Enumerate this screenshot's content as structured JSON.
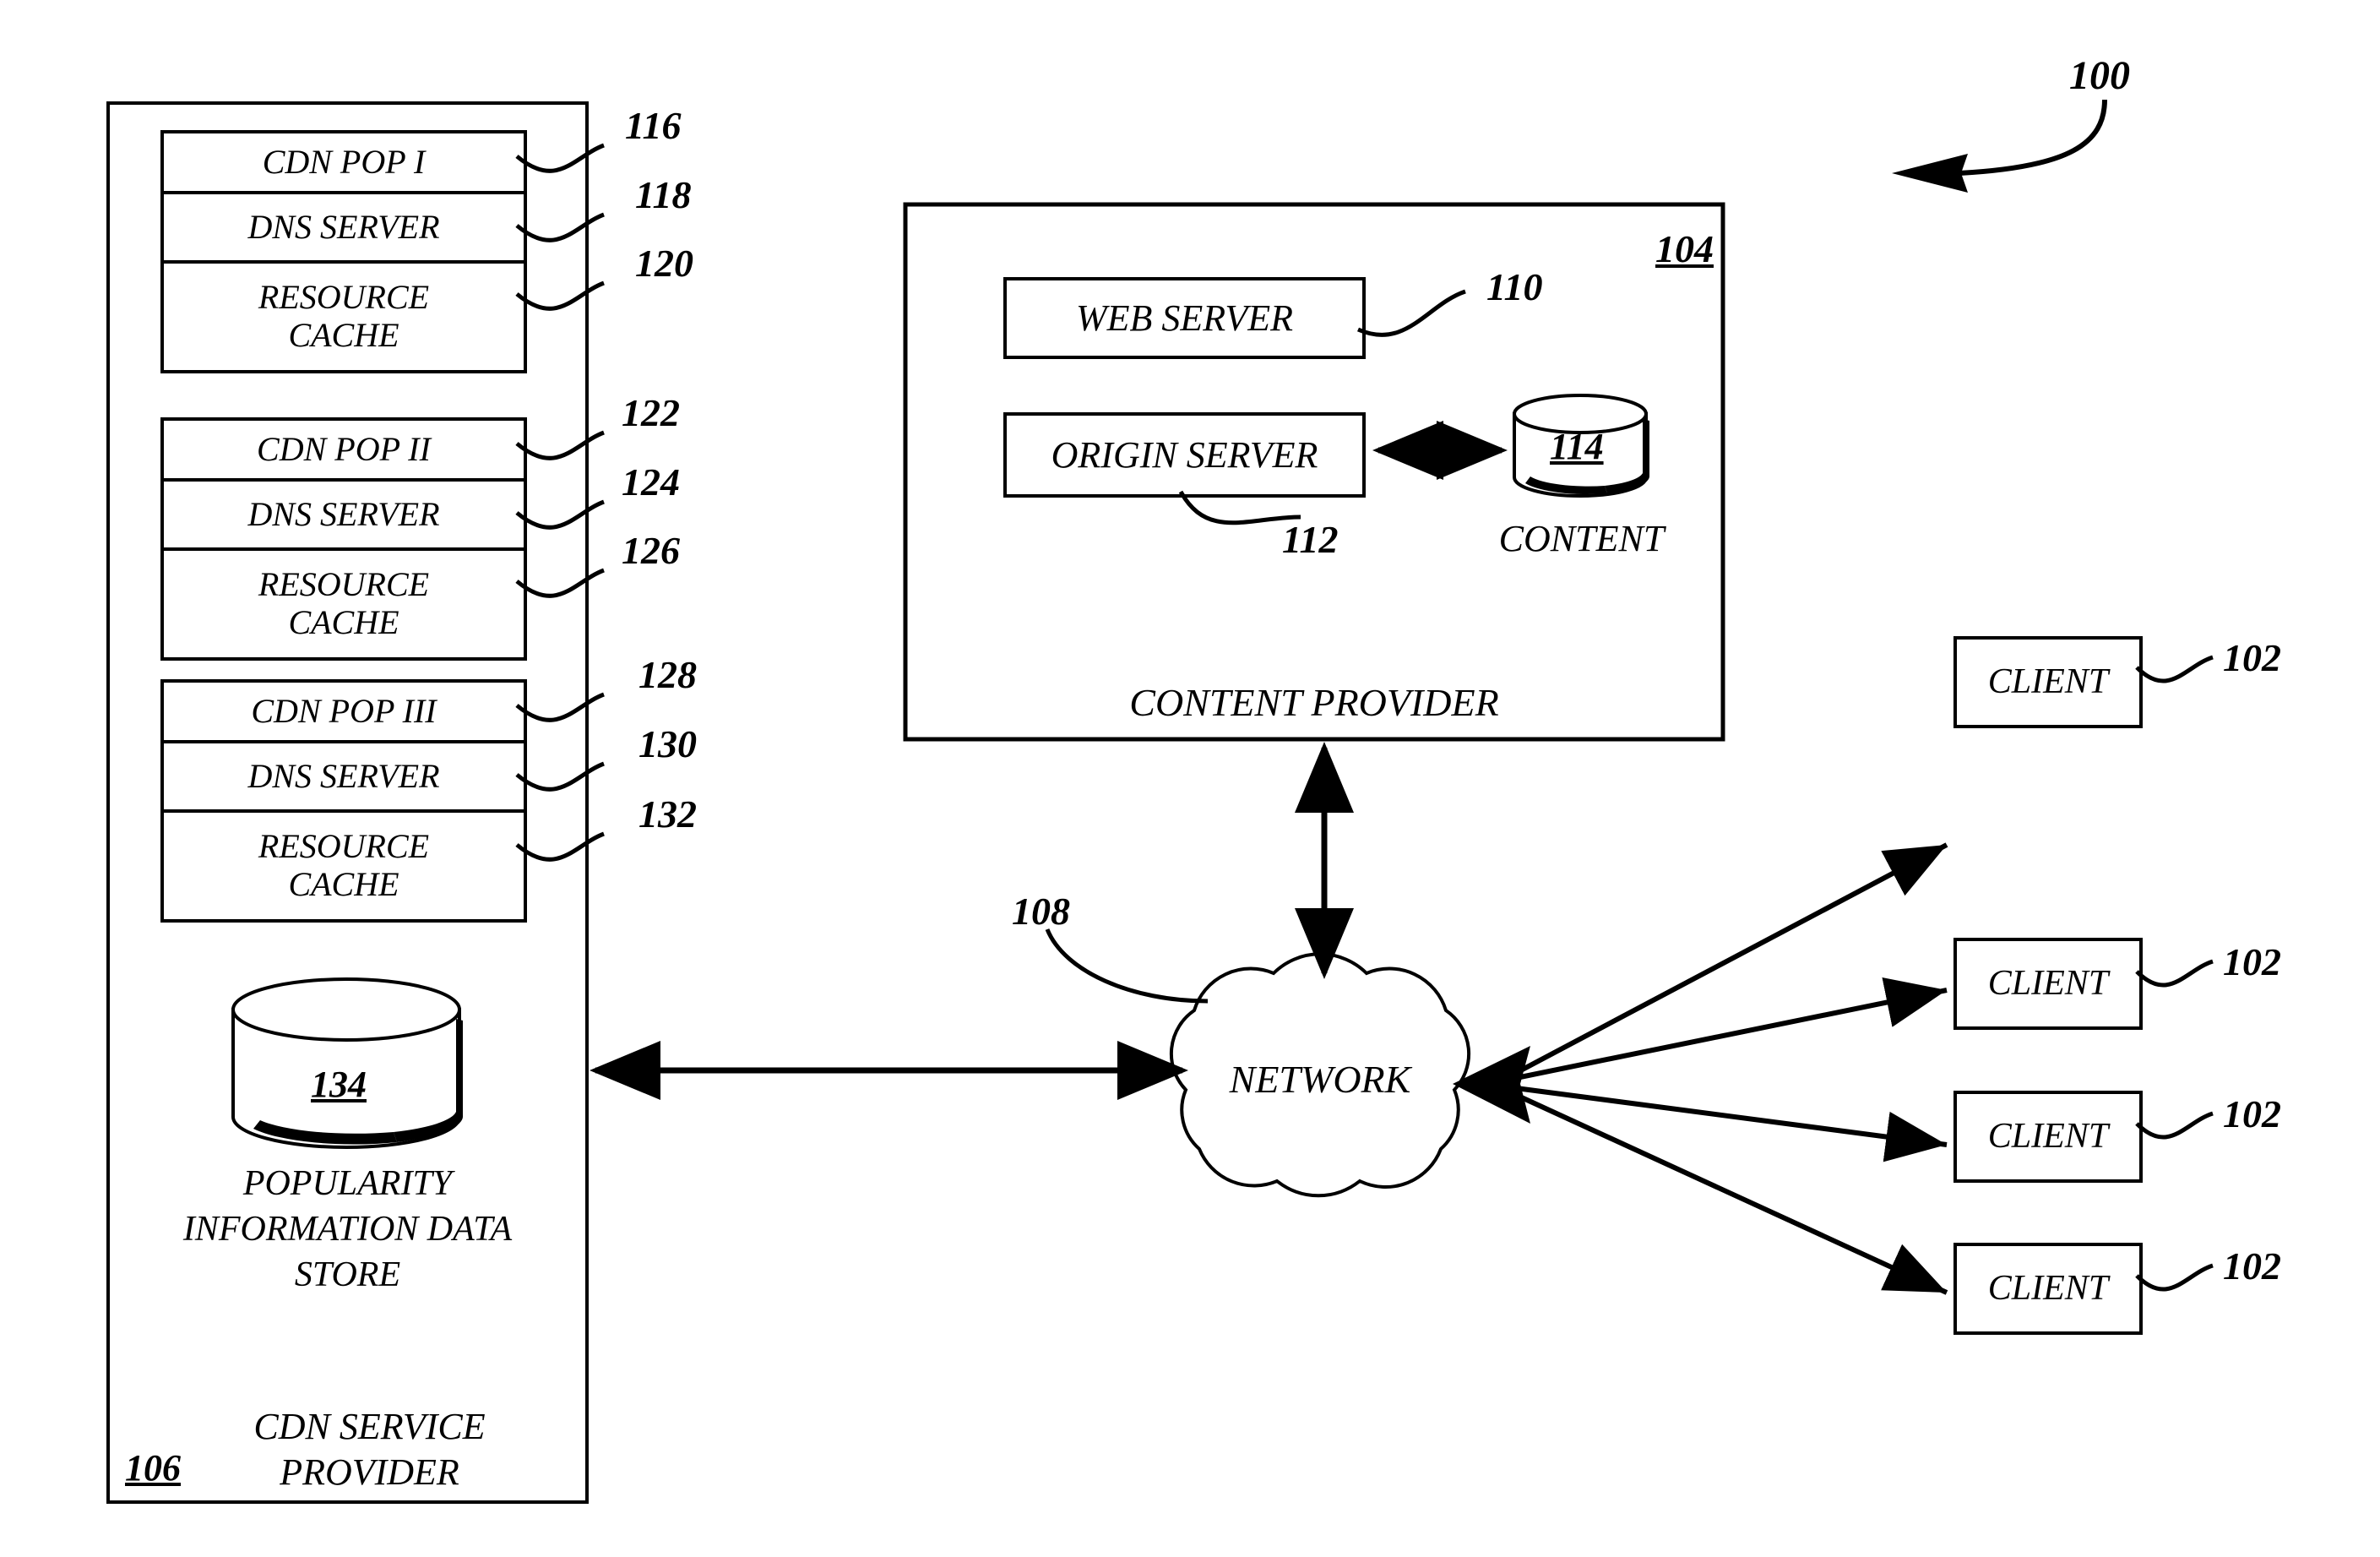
{
  "figure": {
    "overall_ref": "100"
  },
  "cdn_service_provider": {
    "title": "CDN SERVICE\nPROVIDER",
    "title_line1": "CDN SERVICE",
    "title_line2": "PROVIDER",
    "ref": "106",
    "pops": [
      {
        "name": "CDN POP I",
        "name_ref": "116",
        "rows": [
          {
            "label": "DNS SERVER",
            "ref": "118"
          },
          {
            "label": "RESOURCE\nCACHE",
            "label_line1": "RESOURCE",
            "label_line2": "CACHE",
            "ref": "120"
          }
        ]
      },
      {
        "name": "CDN POP II",
        "name_ref": "122",
        "rows": [
          {
            "label": "DNS SERVER",
            "ref": "124"
          },
          {
            "label": "RESOURCE\nCACHE",
            "label_line1": "RESOURCE",
            "label_line2": "CACHE",
            "ref": "126"
          }
        ]
      },
      {
        "name": "CDN POP III",
        "name_ref": "128",
        "rows": [
          {
            "label": "DNS SERVER",
            "ref": "130"
          },
          {
            "label": "RESOURCE\nCACHE",
            "label_line1": "RESOURCE",
            "label_line2": "CACHE",
            "ref": "132"
          }
        ]
      }
    ],
    "data_store": {
      "ref": "134",
      "caption_line1": "POPULARITY",
      "caption_line2": "INFORMATION DATA",
      "caption_line3": "STORE"
    }
  },
  "content_provider": {
    "title": "CONTENT PROVIDER",
    "ref": "104",
    "web_server": {
      "label": "WEB SERVER",
      "ref": "110"
    },
    "origin_server": {
      "label": "ORIGIN SERVER",
      "ref": "112"
    },
    "content_store": {
      "ref": "114",
      "caption": "CONTENT"
    }
  },
  "network": {
    "label": "NETWORK",
    "ref": "108"
  },
  "clients": [
    {
      "label": "CLIENT",
      "ref": "102"
    },
    {
      "label": "CLIENT",
      "ref": "102"
    },
    {
      "label": "CLIENT",
      "ref": "102"
    },
    {
      "label": "CLIENT",
      "ref": "102"
    }
  ],
  "colors": {
    "line": "#000000",
    "background": "#ffffff"
  }
}
